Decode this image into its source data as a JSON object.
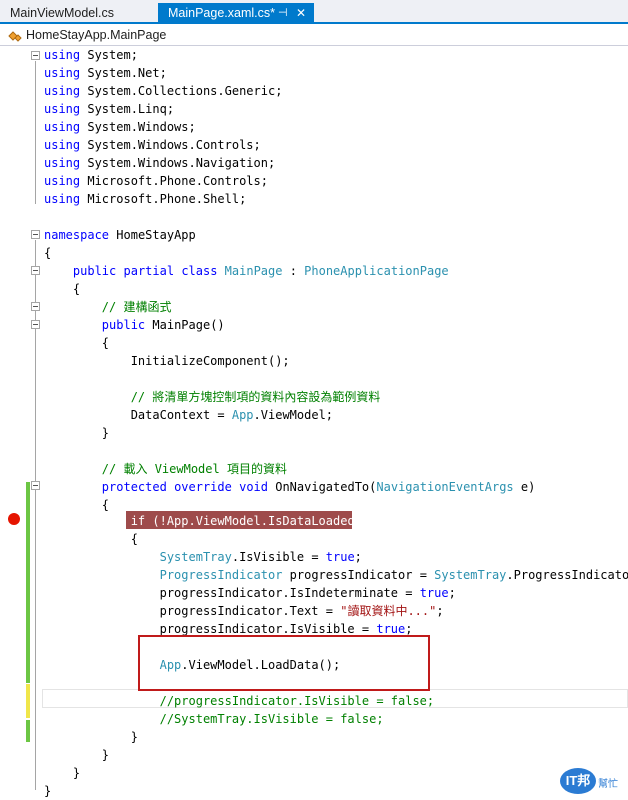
{
  "tabs": {
    "inactive_label": "MainViewModel.cs",
    "active_label": "MainPage.xaml.cs*",
    "pin_glyph": "⊣",
    "close_glyph": "✕"
  },
  "navbar": {
    "breadcrumb": "HomeStayApp.MainPage"
  },
  "code": {
    "u1": "System;",
    "u2": "System.Net;",
    "u3": "System.Collections.Generic;",
    "u4": "System.Linq;",
    "u5": "System.Windows;",
    "u6": "System.Windows.Controls;",
    "u7": "System.Windows.Navigation;",
    "u8": "Microsoft.Phone.Controls;",
    "u9": "Microsoft.Phone.Shell;",
    "kw_using": "using",
    "kw_namespace": "namespace",
    "ns_name": "HomeStayApp",
    "kw_public": "public",
    "kw_partial": "partial",
    "kw_class": "class",
    "class_name": "MainPage",
    "base_sep": " : ",
    "base_class": "PhoneApplicationPage",
    "brace_open": "{",
    "brace_close": "}",
    "comment_ctor": "// 建構函式",
    "ctor_decl": "MainPage()",
    "init_call": "InitializeComponent();",
    "comment_datacontext": "// 將清單方塊控制項的資料內容設為範例資料",
    "dc_left": "DataContext = ",
    "app_type": "App",
    "dc_right": ".ViewModel;",
    "comment_load": "// 載入 ViewModel 項目的資料",
    "kw_protected": "protected",
    "kw_override": "override",
    "kw_void": "void",
    "method_name": "OnNavigatedTo(",
    "arg_type": "NavigationEventArgs",
    "arg_rest": " e)",
    "if_line": "if (!App.ViewModel.IsDataLoaded)",
    "systemtray": "SystemTray",
    "st_visible": ".IsVisible = ",
    "kw_true": "true",
    "semi": ";",
    "pi_type": "ProgressIndicator",
    "pi_decl": " progressIndicator = ",
    "pi_src": ".ProgressIndicator;",
    "pi_indet": "progressIndicator.IsIndeterminate = ",
    "pi_text": "progressIndicator.Text = ",
    "pi_text_val": "\"讀取資料中...\"",
    "pi_visible": "progressIndicator.IsVisible = ",
    "load_call": ".ViewModel.LoadData();",
    "cm_pi": "//progressIndicator.IsVisible = false;",
    "cm_st": "//SystemTray.IsVisible = false;"
  },
  "watermark": {
    "logo": "IT邦",
    "sub": "幫忙"
  }
}
